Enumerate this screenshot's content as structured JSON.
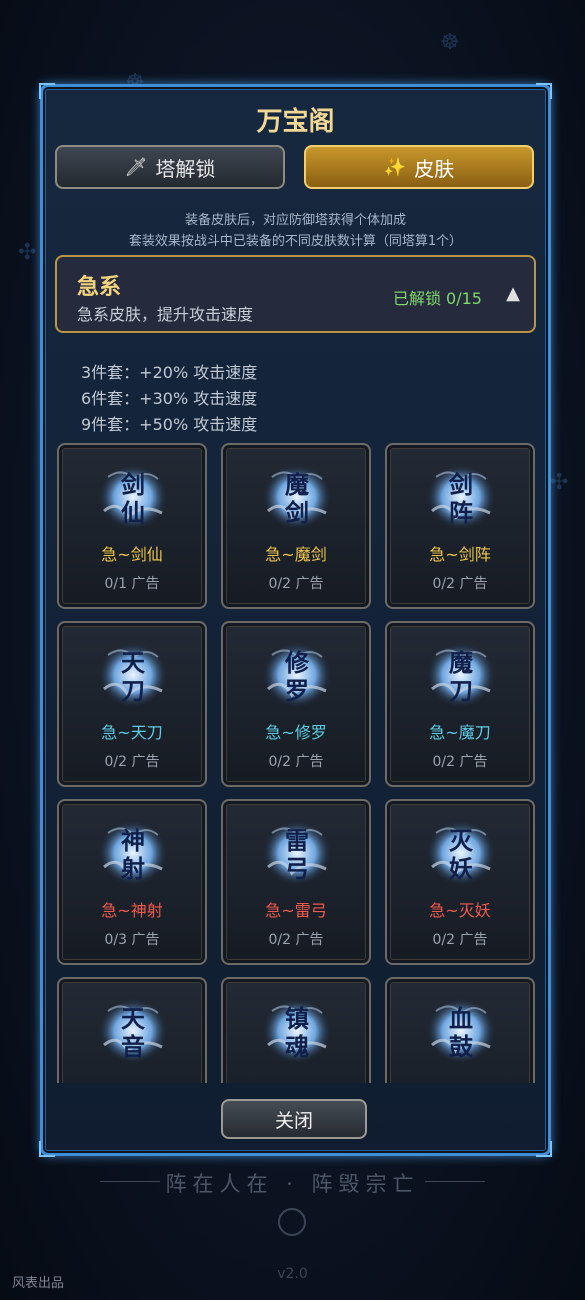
{
  "window": {
    "title": "万宝阁"
  },
  "tabs": [
    {
      "icon": "sword-icon",
      "label": "塔解锁",
      "active": false
    },
    {
      "icon": "sparkle-icon",
      "label": "皮肤",
      "active": true
    }
  ],
  "notes": [
    "装备皮肤后，对应防御塔获得个体加成",
    "套装效果按战斗中已装备的不同皮肤数计算（同塔算1个）"
  ],
  "faction": {
    "name": "急系",
    "description": "急系皮肤，提升攻击速度",
    "unlocked": "已解锁 0/15",
    "toggle_icon": "collapse-triangle-icon"
  },
  "set_bonuses": [
    "3件套：+20% 攻击速度",
    "6件套：+30% 攻击速度",
    "9件套：+50% 攻击速度"
  ],
  "skins": [
    {
      "glyph": "剑仙",
      "name": "急~剑仙",
      "count": "0/1 广告",
      "color": "#f0c64a"
    },
    {
      "glyph": "魔剑",
      "name": "急~魔剑",
      "count": "0/2 广告",
      "color": "#f0c64a"
    },
    {
      "glyph": "剑阵",
      "name": "急~剑阵",
      "count": "0/2 广告",
      "color": "#f0c64a"
    },
    {
      "glyph": "天刀",
      "name": "急~天刀",
      "count": "0/2 广告",
      "color": "#5fcde4"
    },
    {
      "glyph": "修罗",
      "name": "急~修罗",
      "count": "0/2 广告",
      "color": "#5fcde4"
    },
    {
      "glyph": "魔刀",
      "name": "急~魔刀",
      "count": "0/2 广告",
      "color": "#5fcde4"
    },
    {
      "glyph": "神射",
      "name": "急~神射",
      "count": "0/3 广告",
      "color": "#f05a4e"
    },
    {
      "glyph": "雷弓",
      "name": "急~雷弓",
      "count": "0/2 广告",
      "color": "#f05a4e"
    },
    {
      "glyph": "灭妖",
      "name": "急~灭妖",
      "count": "0/2 广告",
      "color": "#f05a4e"
    },
    {
      "glyph": "天音",
      "name": "",
      "count": "",
      "color": "#c58be6"
    },
    {
      "glyph": "镇魂",
      "name": "",
      "count": "",
      "color": "#c58be6"
    },
    {
      "glyph": "血鼓",
      "name": "",
      "count": "",
      "color": "#c58be6"
    }
  ],
  "close_label": "关闭",
  "footer": {
    "motto": "阵在人在 · 阵毁宗亡",
    "version": "v2.0",
    "studio": "风表出品"
  }
}
